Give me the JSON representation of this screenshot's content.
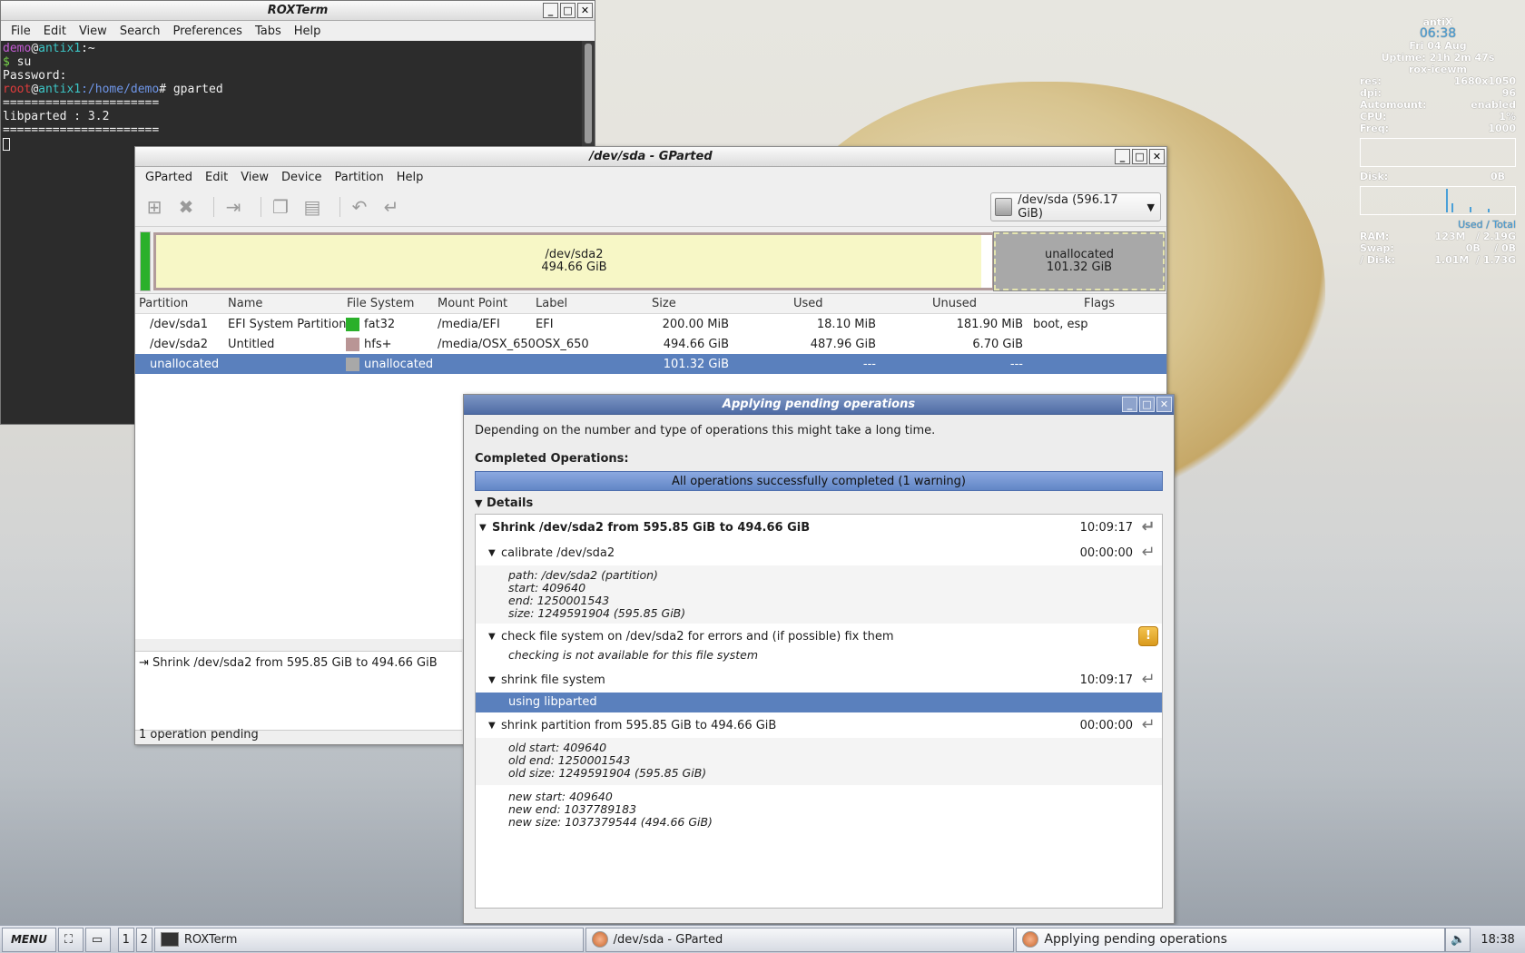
{
  "terminal": {
    "title": "ROXTerm",
    "menu": [
      "File",
      "Edit",
      "View",
      "Search",
      "Preferences",
      "Tabs",
      "Help"
    ],
    "lines": {
      "l1_user": "demo",
      "l1_at": "@",
      "l1_host": "antix1",
      "l1_path": ":~",
      "l2_prompt": "$",
      "l2_cmd": " su",
      "l3": "Password:",
      "l4_user": "root",
      "l4_at": "@",
      "l4_host": "antix1",
      "l4_path": ":/home/demo",
      "l4_cmd": "# gparted",
      "l5": "======================",
      "l6": "libparted : 3.2",
      "l7": "======================"
    }
  },
  "gparted": {
    "title": "/dev/sda - GParted",
    "menu": [
      "GParted",
      "Edit",
      "View",
      "Device",
      "Partition",
      "Help"
    ],
    "device": "/dev/sda  (596.17 GiB)",
    "map": {
      "sda2_name": "/dev/sda2",
      "sda2_size": "494.66 GiB",
      "un_name": "unallocated",
      "un_size": "101.32 GiB"
    },
    "columns": [
      "Partition",
      "Name",
      "File System",
      "Mount Point",
      "Label",
      "Size",
      "Used",
      "Unused",
      "Flags"
    ],
    "rows": [
      {
        "partition": "/dev/sda1",
        "name": "EFI System Partition",
        "fs": "fat32",
        "fs_color": "#2ab02a",
        "mount": "/media/EFI",
        "label": "EFI",
        "size": "200.00 MiB",
        "used": "18.10 MiB",
        "unused": "181.90 MiB",
        "flags": "boot, esp"
      },
      {
        "partition": "/dev/sda2",
        "name": "Untitled",
        "fs": "hfs+",
        "fs_color": "#b99595",
        "mount": "/media/OSX_650",
        "label": "OSX_650",
        "size": "494.66 GiB",
        "used": "487.96 GiB",
        "unused": "6.70 GiB",
        "flags": ""
      },
      {
        "partition": "unallocated",
        "name": "",
        "fs": "unallocated",
        "fs_color": "#a8a8a8",
        "mount": "",
        "label": "",
        "size": "101.32 GiB",
        "used": "---",
        "unused": "---",
        "flags": ""
      }
    ],
    "pending_op": "Shrink /dev/sda2 from 595.85 GiB to 494.66 GiB",
    "status": "1 operation pending"
  },
  "dialog": {
    "title": "Applying pending operations",
    "intro": "Depending on the number and type of operations this might take a long time.",
    "completed_label": "Completed Operations:",
    "progress_text": "All operations successfully completed (1 warning)",
    "details_label": "Details",
    "op1": {
      "text": "Shrink /dev/sda2 from 595.85 GiB to 494.66 GiB",
      "time": "10:09:17"
    },
    "calibrate": {
      "text": "calibrate /dev/sda2",
      "time": "00:00:00",
      "info": [
        "path: /dev/sda2 (partition)",
        "start: 409640",
        "end: 1250001543",
        "size: 1249591904 (595.85 GiB)"
      ]
    },
    "check": {
      "text": "check file system on /dev/sda2 for errors and (if possible) fix them",
      "info": "checking is not available for this file system"
    },
    "shrinkfs": {
      "text": "shrink file system",
      "time": "10:09:17",
      "info": "using libparted"
    },
    "shrinkpart": {
      "text": "shrink partition from 595.85 GiB to 494.66 GiB",
      "time": "00:00:00",
      "old": [
        "old start: 409640",
        "old end: 1250001543",
        "old size: 1249591904 (595.85 GiB)"
      ],
      "new": [
        "new start: 409640",
        "new end: 1037789183",
        "new size: 1037379544 (494.66 GiB)"
      ]
    }
  },
  "conky": {
    "host": "antiX",
    "time": "06:38",
    "date": "Fri 04 Aug",
    "uptime": "Uptime: 21h 2m 47s",
    "wm": "rox-icewm",
    "res_k": "res:",
    "res_v": "1680x1050",
    "dpi_k": "dpi:",
    "dpi_v": "96",
    "auto_k": "Automount:",
    "auto_v": "enabled",
    "cpu_k": "CPU:",
    "cpu_v": "1%",
    "freq_k": "Freq:",
    "freq_v": "1000",
    "disk_k": "Disk:",
    "disk_v": "0B",
    "used_total": "Used / Total",
    "ram_k": "RAM:",
    "ram_v": "123M   / 2.19G",
    "swap_k": "Swap:",
    "swap_v": "0B    / 0B",
    "rdisk_k": "/ Disk:",
    "rdisk_v": "1.01M  / 1.73G",
    "accent": "#4aa0d8"
  },
  "taskbar": {
    "menu": "MENU",
    "ws1": "1",
    "ws2": "2",
    "task1": "ROXTerm",
    "task2": "/dev/sda - GParted",
    "task3": "Applying pending operations",
    "clock": "18:38"
  }
}
